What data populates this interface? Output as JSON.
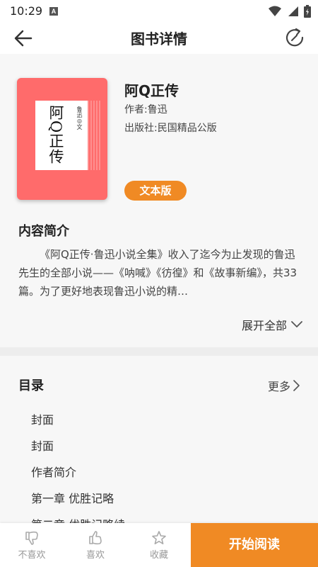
{
  "status_bar": {
    "time": "10:29",
    "notification_letter": "A"
  },
  "app_bar": {
    "title": "图书详情"
  },
  "book": {
    "title": "阿Q正传",
    "author": "作者:鲁迅",
    "publisher": "出版社:民国精品公版",
    "format_badge": "文本版",
    "cover": {
      "title": "阿Q正传",
      "author": "鲁迅◎文",
      "color": "#ff6b6b"
    }
  },
  "intro": {
    "heading": "内容简介",
    "text": "《阿Q正传·鲁迅小说全集》收入了迄今为止发现的鲁迅先生的全部小说——《呐喊》《彷徨》和《故事新编》，共33篇。为了更好地表现鲁迅小说的精…",
    "expand_label": "展开全部"
  },
  "toc": {
    "heading": "目录",
    "more_label": "更多",
    "items": [
      "封面",
      "封面",
      "作者简介",
      "第一章 优胜记略",
      "第二章 优胜记略续"
    ]
  },
  "bottom_bar": {
    "dislike_label": "不喜欢",
    "like_label": "喜欢",
    "collect_label": "收藏",
    "start_label": "开始阅读",
    "accent_color": "#f08a24"
  }
}
